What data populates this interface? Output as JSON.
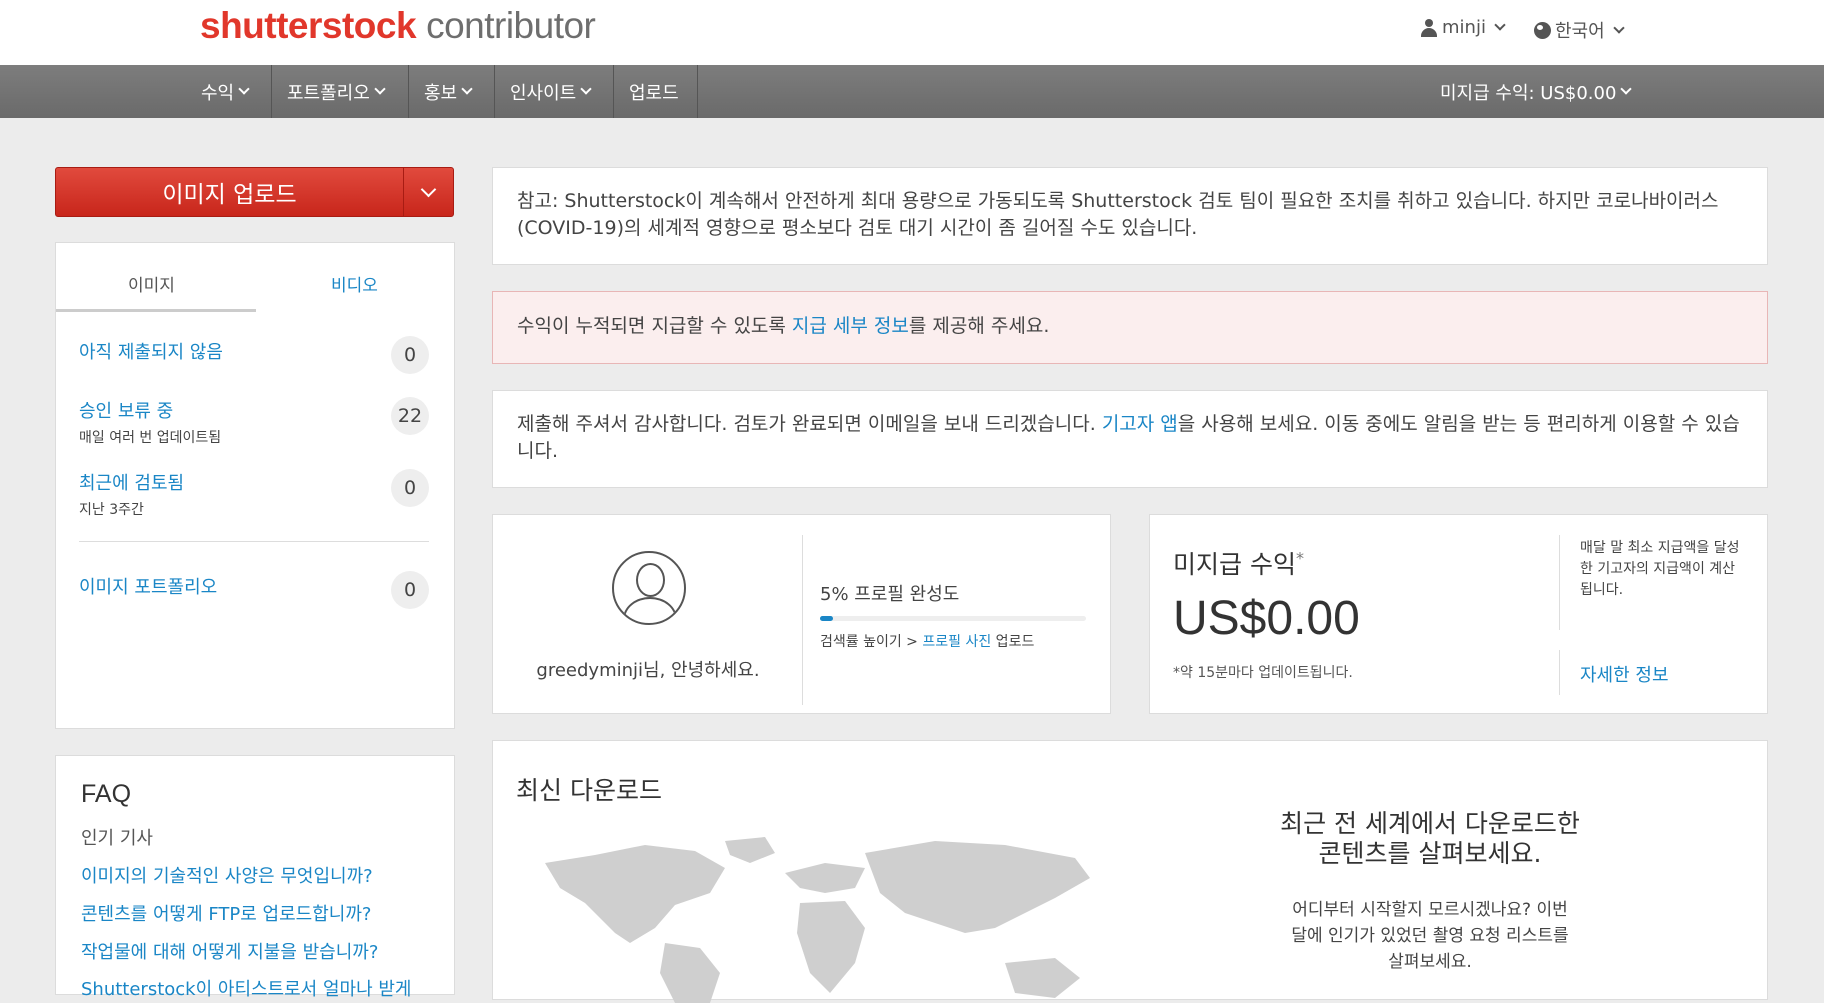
{
  "header": {
    "logo_brand": "shutterstock",
    "logo_sub": "contributor",
    "user": "minji",
    "language": "한국어"
  },
  "nav": {
    "items": [
      {
        "label": "수익",
        "dropdown": true
      },
      {
        "label": "포트폴리오",
        "dropdown": true
      },
      {
        "label": "홍보",
        "dropdown": true
      },
      {
        "label": "인사이트",
        "dropdown": true
      },
      {
        "label": "업로드",
        "dropdown": false
      }
    ],
    "earnings": "미지급 수익: US$0.00"
  },
  "upload": {
    "label": "이미지 업로드"
  },
  "stats": {
    "tabs": [
      "이미지",
      "비디오"
    ],
    "rows": [
      {
        "title": "아직 제출되지 않음",
        "sub": "",
        "count": "0"
      },
      {
        "title": "승인 보류 중",
        "sub": "매일 여러 번 업데이트됨",
        "count": "22"
      },
      {
        "title": "최근에 검토됨",
        "sub": "지난 3주간",
        "count": "0"
      },
      {
        "title": "이미지 포트폴리오",
        "sub": "",
        "count": "0"
      }
    ]
  },
  "faq": {
    "title": "FAQ",
    "subtitle": "인기 기사",
    "links": [
      "이미지의 기술적인 사양은 무엇입니까?",
      "콘텐츠를 어떻게 FTP로 업로드합니까?",
      "작업물에 대해 어떻게 지불을 받습니까?",
      "Shutterstock이 아티스트로서 얼마나 받게"
    ]
  },
  "notices": {
    "covid": "참고: Shutterstock이 계속해서 안전하게 최대 용량으로 가동되도록 Shutterstock 검토 팀이 필요한 조치를 취하고 있습니다. 하지만 코로나바이러스(COVID-19)의 세계적 영향으로 평소보다 검토 대기 시간이 좀 길어질 수도 있습니다.",
    "payout_before": "수익이 누적되면 지급할 수 있도록 ",
    "payout_link": "지급 세부 정보",
    "payout_after": "를 제공해 주세요.",
    "thanks_before": "제출해 주셔서 감사합니다. 검토가 완료되면 이메일을 보내 드리겠습니다. ",
    "thanks_link": "기고자 앱",
    "thanks_after": "을 사용해 보세요. 이동 중에도 알림을 받는 등 편리하게 이용할 수 있습니다."
  },
  "profile": {
    "greeting": "greedyminji님, 안녕하세요.",
    "completion_label": "5% 프로필 완성도",
    "completion": 0.05,
    "tip_before": "검색률 높이기 > ",
    "tip_link": "프로필 사진",
    "tip_after": " 업로드"
  },
  "unpaid": {
    "title": "미지급 수익",
    "asterisk": "*",
    "amount": "US$0.00",
    "note": "*약 15분마다 업데이트됩니다.",
    "side_note": "매달 말 최소 지급액을 달성한 기고자의 지급액이 계산됩니다.",
    "more_link": "자세한 정보"
  },
  "downloads": {
    "title": "최신 다운로드",
    "headline": "최근 전 세계에서 다운로드한 콘텐츠를 살펴보세요.",
    "body": "어디부터 시작할지 모르시겠나요? 이번 달에 인기가 있었던 촬영 요청 리스트를 살펴보세요."
  }
}
